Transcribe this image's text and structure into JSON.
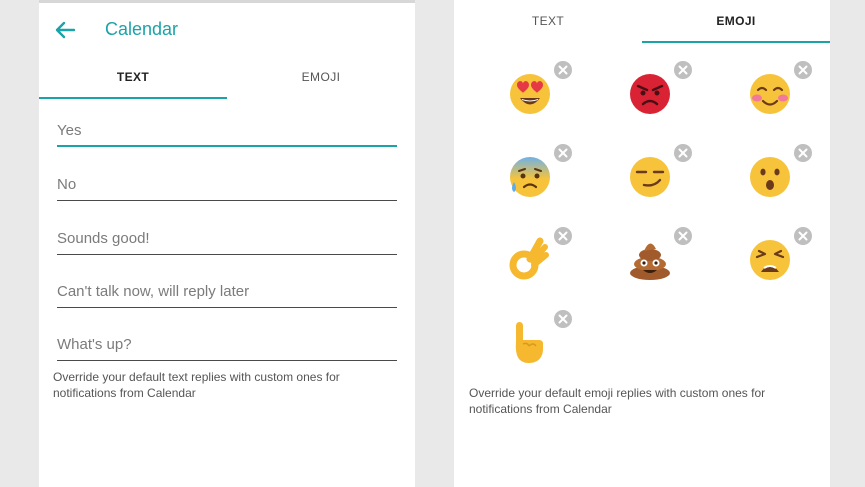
{
  "text_screen": {
    "title": "Calendar",
    "tabs": [
      {
        "label": "TEXT",
        "active": true
      },
      {
        "label": "EMOJI",
        "active": false
      }
    ],
    "replies": [
      "Yes",
      "No",
      "Sounds good!",
      "Can't talk now, will reply later",
      "What's up?"
    ],
    "help_text": "Override your default text replies with custom ones for notifications from Calendar"
  },
  "emoji_screen": {
    "tabs": [
      {
        "label": "TEXT",
        "active": false
      },
      {
        "label": "EMOJI",
        "active": true
      }
    ],
    "emojis": [
      "heart-eyes-emoji",
      "angry-face-emoji",
      "blushing-smile-emoji",
      "anxious-sweat-emoji",
      "smirk-emoji",
      "hushed-face-emoji",
      "ok-hand-emoji",
      "pile-of-poo-emoji",
      "weary-face-emoji",
      "pointing-up-hand-emoji"
    ],
    "help_text": "Override your default emoji replies with custom ones for notifications from Calendar"
  },
  "colors": {
    "accent": "#1aa3a8",
    "background": "#e9e9e9",
    "emoji_yellow": "#f7c33b",
    "angry_red": "#d92334",
    "remove_button": "#bfbfbf"
  }
}
